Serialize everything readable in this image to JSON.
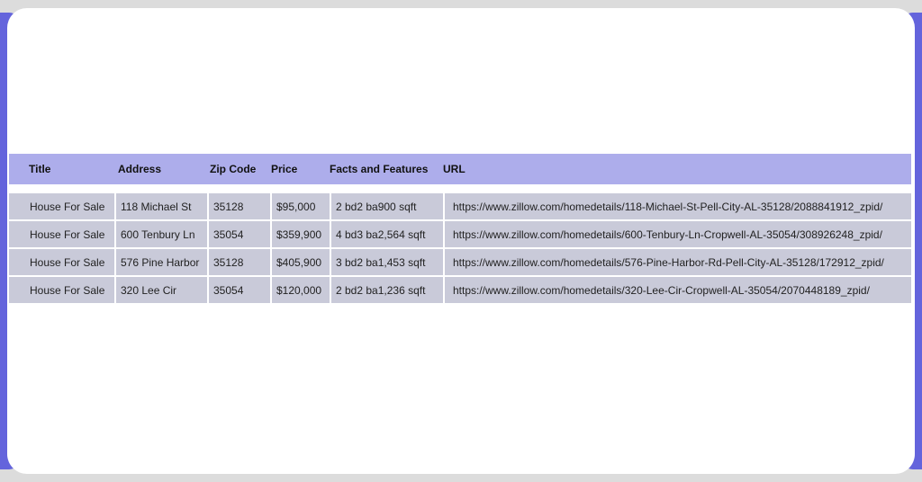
{
  "accent": "#6464dc",
  "table": {
    "headers": [
      "Title",
      "Address",
      "Zip Code",
      "Price",
      "Facts and Features",
      "URL"
    ],
    "rows": [
      [
        "House For Sale",
        "118 Michael St",
        "35128",
        "$95,000",
        "2 bd2 ba900 sqft",
        "https://www.zillow.com/homedetails/118-Michael-St-Pell-City-AL-35128/2088841912_zpid/"
      ],
      [
        "House For Sale",
        "600 Tenbury Ln",
        "35054",
        "$359,900",
        "4 bd3 ba2,564 sqft",
        "https://www.zillow.com/homedetails/600-Tenbury-Ln-Cropwell-AL-35054/308926248_zpid/"
      ],
      [
        "House For Sale",
        "576 Pine Harbor",
        "35128",
        "$405,900",
        "3 bd2 ba1,453 sqft",
        "https://www.zillow.com/homedetails/576-Pine-Harbor-Rd-Pell-City-AL-35128/172912_zpid/"
      ],
      [
        "House For Sale",
        "320 Lee Cir",
        "35054",
        "$120,000",
        "2 bd2 ba1,236 sqft",
        "https://www.zillow.com/homedetails/320-Lee-Cir-Cropwell-AL-35054/2070448189_zpid/"
      ]
    ]
  }
}
